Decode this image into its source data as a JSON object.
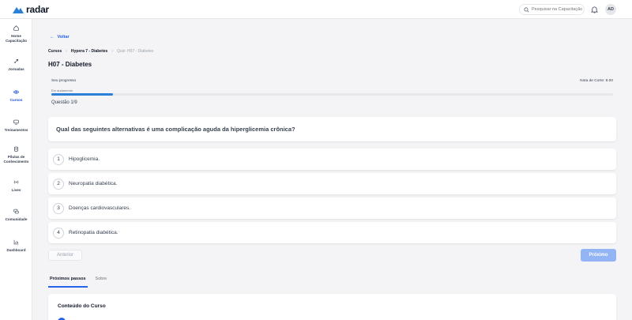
{
  "brand": {
    "name": "radar",
    "color": "#2b7fd6"
  },
  "search": {
    "placeholder": "Pesquisar na Capacitação"
  },
  "user": {
    "initials": "AD"
  },
  "sidebar": {
    "items": [
      {
        "label": "Home Capacitação",
        "icon": "home-icon"
      },
      {
        "label": "Jornadas",
        "icon": "rocket-icon"
      },
      {
        "label": "Cursos",
        "icon": "eye-icon",
        "active": true
      },
      {
        "label": "Treinamentos",
        "icon": "monitor-icon"
      },
      {
        "label": "Pílulas de Conhecimento",
        "icon": "clipboard-icon"
      },
      {
        "label": "Lives",
        "icon": "broadcast-icon"
      },
      {
        "label": "Comunidade",
        "icon": "chat-icon"
      },
      {
        "label": "Dashboard",
        "icon": "chart-icon"
      }
    ]
  },
  "nav": {
    "back": "Voltar"
  },
  "breadcrumb": {
    "a": "Cursos",
    "b": "Hypera 7 - Diabetes",
    "c": "Quiz: H07 - Diabetes",
    "sep": "›"
  },
  "page": {
    "title": "H07 - Diabetes"
  },
  "progress": {
    "label": "Seu progresso",
    "nota": "Nota de Corte: 8.00",
    "status": "Em andamento",
    "fraction": 0.11,
    "question_counter": "Questão 1/9"
  },
  "question": {
    "text": "Qual das seguintes alternativas é uma complicação aguda da hiperglicemia crônica?"
  },
  "options": [
    {
      "num": "1",
      "text": "Hipoglicemia."
    },
    {
      "num": "2",
      "text": "Neuropatia diabética."
    },
    {
      "num": "3",
      "text": "Doenças cardiovasculares."
    },
    {
      "num": "4",
      "text": "Retinopatia diabética."
    }
  ],
  "buttons": {
    "prev": "Anterior",
    "next": "Próximo"
  },
  "tabs": [
    {
      "label": "Próximos passos",
      "active": true
    },
    {
      "label": "Sobre",
      "active": false
    }
  ],
  "content": {
    "title": "Conteúdo do Curso"
  },
  "colors": {
    "accent": "#2563eb",
    "next_disabled": "#93b4f5",
    "progress": "#2b7fd6"
  }
}
